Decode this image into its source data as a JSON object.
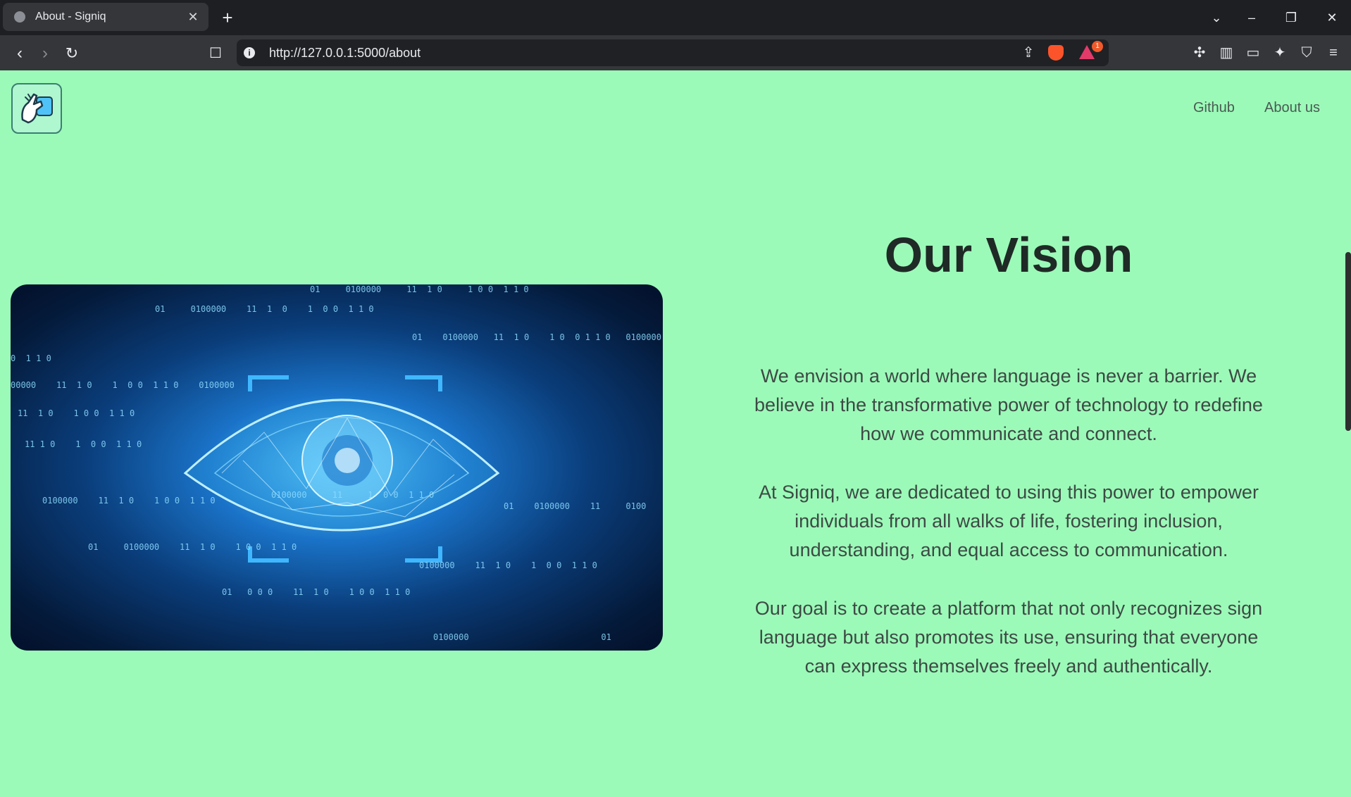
{
  "browser": {
    "tab_title": "About - Signiq",
    "url": "http://127.0.0.1:5000/about",
    "notification_count": "1",
    "icons": [
      "globe-icon",
      "close-icon",
      "plus-icon",
      "chevron-down-icon",
      "minimize-icon",
      "restore-icon",
      "back-icon",
      "forward-icon",
      "reload-icon",
      "bookmark-icon",
      "info-icon",
      "share-icon",
      "brave-shield-icon",
      "rewards-icon",
      "extensions-icon",
      "sidebar-icon",
      "wallet-icon",
      "leo-icon",
      "vpn-icon",
      "menu-icon"
    ]
  },
  "nav": {
    "links": [
      "Github",
      "About us"
    ]
  },
  "vision": {
    "heading": "Our Vision",
    "paragraphs": [
      "We envision a world where language is never a barrier. We believe in the transformative power of technology to redefine how we communicate and connect.",
      "At Signiq, we are dedicated to using this power to empower individuals from all walks of life, fostering inclusion, understanding, and equal access to communication.",
      "Our goal is to create a platform that not only recognizes sign language but also promotes its use, ensuring that everyone can express themselves freely and authentically."
    ]
  },
  "colors": {
    "page_background": "#9cfab9",
    "heading": "#1f2a26",
    "body_text": "#3d4a44",
    "nav_text": "#4a5a52"
  }
}
